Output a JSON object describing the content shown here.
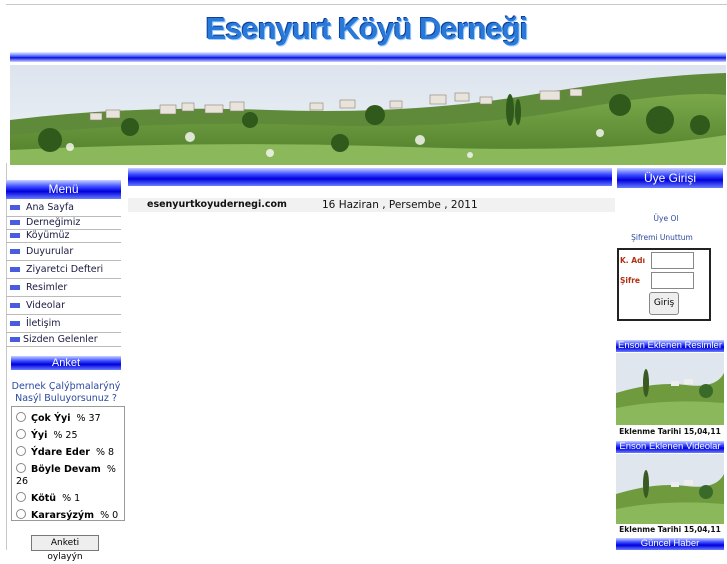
{
  "header": {
    "title": "Esenyurt Köyü Derneği"
  },
  "menu": {
    "title": "Menü",
    "items": [
      {
        "label": "Ana Sayfa"
      },
      {
        "label": "Derneğimiz"
      },
      {
        "label": "Köyümüz"
      },
      {
        "label": "Duyurular"
      },
      {
        "label": "Ziyaretci Defteri"
      },
      {
        "label": "Resimler"
      },
      {
        "label": "Videolar"
      },
      {
        "label": "İletişim"
      },
      {
        "label": "Sizden Gelenler"
      }
    ]
  },
  "poll": {
    "title": "Anket",
    "question": "Dernek Çalýþmalarýný Nasýl Buluyorsunuz ?",
    "options": [
      {
        "label": "Çok Ýyi",
        "percent": "% 37"
      },
      {
        "label": "Ýyi",
        "percent": "% 25"
      },
      {
        "label": "Ýdare Eder",
        "percent": "% 8"
      },
      {
        "label": "Böyle Devam",
        "percent": "% 26"
      },
      {
        "label": "Kötü",
        "percent": "% 1"
      },
      {
        "label": "Kararsýzým",
        "percent": "% 0"
      }
    ],
    "vote_label": "Anketi oylayýn"
  },
  "content": {
    "site_name": "esenyurtkoyudernegi.com",
    "date": "16 Haziran , Persembe , 2011"
  },
  "login": {
    "title": "Üye Girişi",
    "register_link": "Üye Ol",
    "forgot_link": "Şifremi Unuttum",
    "username_label": "K. Adı",
    "password_label": "Şifre",
    "submit_label": "Giriş"
  },
  "latest_images": {
    "title": "Enson Eklenen Resimler",
    "caption": "Eklenme Tarihi 15,04,11"
  },
  "latest_videos": {
    "title": "Enson Eklenen Videolar",
    "caption": "Eklenme Tarihi 15,04,11"
  },
  "news": {
    "title": "Güncel Haber"
  }
}
